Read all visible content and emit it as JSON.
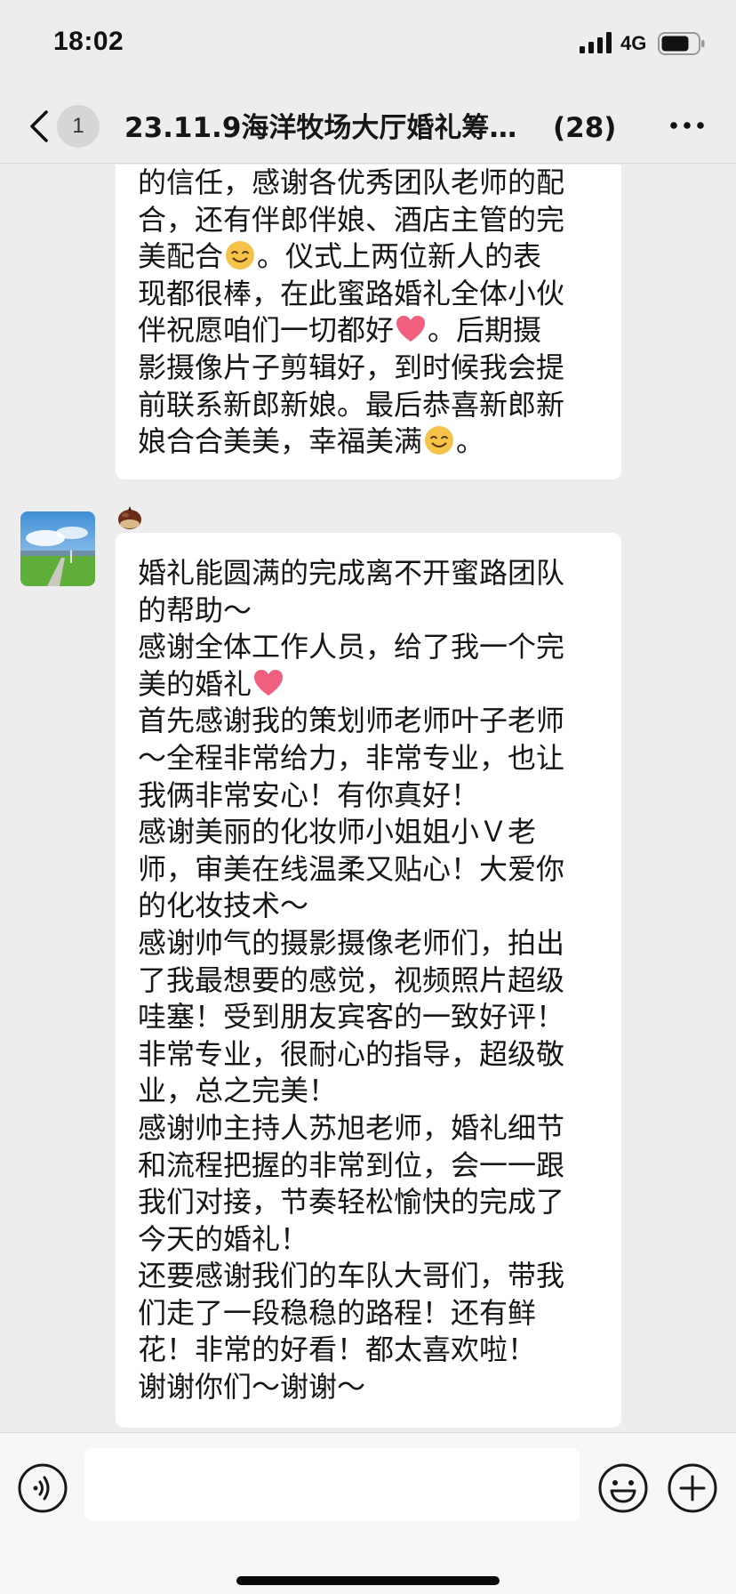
{
  "status_bar": {
    "time": "18:02",
    "network": "4G",
    "icons": [
      "signal-icon",
      "battery-icon"
    ]
  },
  "nav": {
    "back_icon": "chevron-left-icon",
    "unread_count": "1",
    "title": "23.11.9海洋牧场大厅婚礼筹…",
    "member_count": "(28)",
    "more_icon": "more-dots-icon"
  },
  "messages": [
    {
      "lines": [
        "的信任，感谢各优秀团队老师的配",
        "合，还有伴郎伴娘、酒店主管的完",
        "美配合[smile]。仪式上两位新人的表",
        "现都很棒，在此蜜路婚礼全体小伙",
        "伴祝愿咱们一切都好[heart]。后期摄",
        "影摄像片子剪辑好，到时候我会提",
        "前联系新郎新娘。最后恭喜新郎新",
        "娘合合美美，幸福美满[smile]。"
      ]
    },
    {
      "sender_icon": "chestnut-icon",
      "avatar": "landscape-avatar",
      "lines": [
        "婚礼能圆满的完成离不开蜜路团队",
        "的帮助～",
        "感谢全体工作人员，给了我一个完",
        "美的婚礼[heart]",
        "首先感谢我的策划师老师叶子老师",
        "～全程非常给力，非常专业，也让",
        "我俩非常安心！有你真好！",
        "感谢美丽的化妆师小姐姐小Ｖ老",
        "师，审美在线温柔又贴心！大爱你",
        "的化妆技术～",
        "感谢帅气的摄影摄像老师们，拍出",
        "了我最想要的感觉，视频照片超级",
        "哇塞！受到朋友宾客的一致好评！",
        "非常专业，很耐心的指导，超级敬",
        "业，总之完美！",
        "感谢帅主持人苏旭老师，婚礼细节",
        "和流程把握的非常到位，会一一跟",
        "我们对接，节奏轻松愉快的完成了",
        "今天的婚礼！",
        "还要感谢我们的车队大哥们，带我",
        "们走了一段稳稳的路程！还有鲜",
        "花！非常的好看！都太喜欢啦！",
        "谢谢你们～谢谢～"
      ]
    }
  ],
  "input_bar": {
    "placeholder": "",
    "voice_icon": "voice-icon",
    "emoji_icon": "emoji-icon",
    "plus_icon": "plus-icon"
  },
  "colors": {
    "background": "#ededed",
    "bubble": "#ffffff",
    "input_bar": "#f7f7f7",
    "heart": "#f0607e",
    "smile": "#f6c34a"
  }
}
